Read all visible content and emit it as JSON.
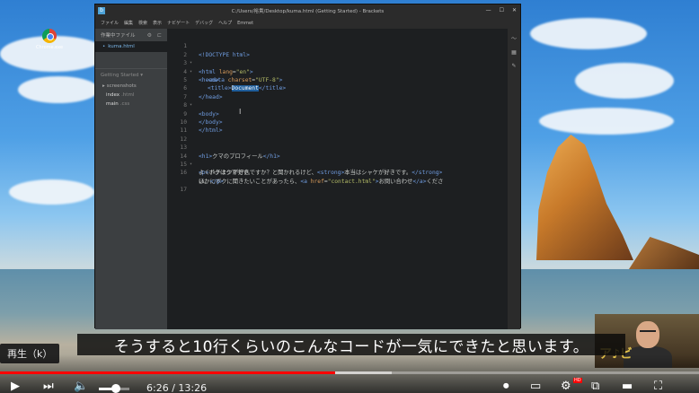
{
  "desktop": {
    "icon_label": "Chrome.exe"
  },
  "window": {
    "title": "C:/Users/裕貴/Desktop/kuma.html (Getting Started) - Brackets",
    "logo": "b",
    "controls": {
      "minimize": "—",
      "maximize": "☐",
      "close": "✕"
    }
  },
  "menu": [
    "ファイル",
    "編集",
    "検索",
    "表示",
    "ナビゲート",
    "デバッグ",
    "ヘルプ",
    "Emmet"
  ],
  "sidebar": {
    "working_files_label": "作業中ファイル",
    "active_file": "kuma.html",
    "project_label": "Getting Started ▾",
    "folder": "screenshots",
    "files": [
      {
        "name": "index",
        "ext": ".html"
      },
      {
        "name": "main",
        "ext": ".css"
      }
    ]
  },
  "editor": {
    "line_numbers": [
      "1",
      "2",
      "3",
      "4",
      "5",
      "6",
      "7",
      "8",
      "9",
      "10",
      "11",
      "12",
      "13",
      "14",
      "15",
      "16",
      "17"
    ],
    "lines": {
      "l1": "<!DOCTYPE html>",
      "l2a": "<html ",
      "l2b": "lang",
      "l2c": "=",
      "l2d": "\"en\"",
      "l2e": ">",
      "l3": "<head>",
      "l4a": "<meta ",
      "l4b": "charset",
      "l4c": "=",
      "l4d": "\"UTF-8\"",
      "l4e": ">",
      "l5a": "<title>",
      "l5b": "Document",
      "l5c": "</title>",
      "l6": "</head>",
      "l7": "<body>",
      "l9": "</body>",
      "l10": "</html>",
      "l13a": "<h1>",
      "l13b": "クマのプロフィール",
      "l13c": "</h1>",
      "l14a": "<p>",
      "l14b": "ボクはクマです。",
      "l15a": "よくハチミツが好きですか？と聞かれるけど、",
      "l15b": "<strong>",
      "l15c": "本当はシャケが好きです。",
      "l15d": "</strong>",
      "l16a": "ほかにボクに聞きたいことがあったら、",
      "l16b": "<a ",
      "l16c": "href",
      "l16d": "=",
      "l16e": "\"contact.html\"",
      "l16f": ">",
      "l16g": "お問い合わせ",
      "l16h": "</a>",
      "l16i": "くださ",
      "l16j": "い。",
      "l16k": "</p>"
    }
  },
  "video": {
    "subtitle": "そうすると10行くらいのこんなコードが一気にできたと思います。",
    "tooltip": "再生（k）",
    "current_time": "6:26",
    "duration": "13:26",
    "time_separator": " / ",
    "progress_played_fraction": 0.479,
    "progress_buffer_fraction": 0.56,
    "volume_fraction": 0.5,
    "hd_badge": "HD",
    "webcam_logo": "ア♪ビ"
  }
}
